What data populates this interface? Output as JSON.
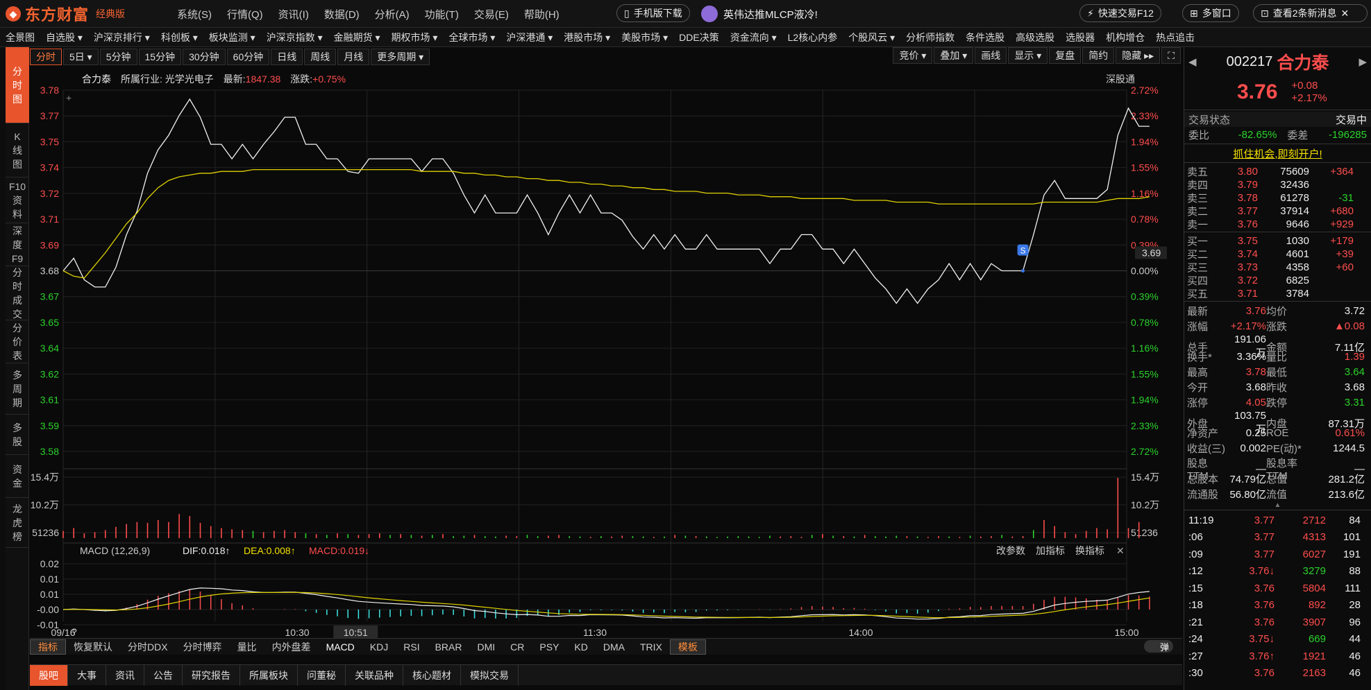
{
  "app": {
    "brand": "东方财富",
    "edition": "经典版"
  },
  "menu": [
    "系统(S)",
    "行情(Q)",
    "资讯(I)",
    "数据(D)",
    "分析(A)",
    "功能(T)",
    "交易(E)",
    "帮助(H)"
  ],
  "topbar": {
    "mobile_download": "手机版下载",
    "news_banner": "英伟达推MLCP液冷!",
    "quick_trade": "快速交易F12",
    "multi_window": "多窗口",
    "new_messages": "查看2条新消息"
  },
  "nav": [
    "全景图",
    "自选股 ▾",
    "沪深京排行 ▾",
    "科创板 ▾",
    "板块监测 ▾",
    "沪深京指数 ▾",
    "金融期货 ▾",
    "期权市场 ▾",
    "全球市场 ▾",
    "沪深港通 ▾",
    "港股市场 ▾",
    "美股市场 ▾",
    "DDE决策",
    "资金流向 ▾",
    "L2核心内参",
    "个股风云 ▾",
    "分析师指数",
    "条件选股",
    "高级选股",
    "选股器",
    "机构增仓",
    "热点追击"
  ],
  "left_tabs": [
    {
      "label": "分\n时\n图",
      "active": true
    },
    {
      "label": "K\n线\n图",
      "active": false
    },
    {
      "label": "F10\n资\n料",
      "active": false
    },
    {
      "label": "深\n度\nF9",
      "active": false
    },
    {
      "label": "分\n时\n成\n交",
      "active": false
    },
    {
      "label": "分\n价\n表",
      "active": false
    },
    {
      "label": "多\n周\n期",
      "active": false
    },
    {
      "label": "多\n股",
      "active": false
    },
    {
      "label": "资\n金",
      "active": false
    },
    {
      "label": "龙\n虎\n榜",
      "active": false
    }
  ],
  "periods": [
    "分时",
    "5日 ▾",
    "5分钟",
    "15分钟",
    "30分钟",
    "60分钟",
    "日线",
    "周线",
    "月线",
    "更多周期 ▾"
  ],
  "chart_tools": [
    "竞价 ▾",
    "叠加 ▾",
    "画线",
    "显示 ▾",
    "复盘",
    "简约",
    "隐藏 ▸▸"
  ],
  "info": {
    "name": "合力泰",
    "industry_label": "所属行业:",
    "industry": "光学光电子",
    "latest_label": "最新:",
    "latest": "1847.38",
    "change_label": "涨跌:",
    "change": "+0.75%",
    "connect": "深股通"
  },
  "chart_data": {
    "type": "line",
    "price_ticks_left": [
      "3.78",
      "3.77",
      "3.75",
      "3.74",
      "3.72",
      "3.71",
      "3.69",
      "3.68",
      "3.67",
      "3.65",
      "3.64",
      "3.62",
      "3.61",
      "3.59",
      "3.58"
    ],
    "pct_ticks_right": [
      "2.72%",
      "2.33%",
      "1.94%",
      "1.55%",
      "1.16%",
      "0.78%",
      "0.39%",
      "0.00%",
      "0.39%",
      "0.78%",
      "1.16%",
      "1.55%",
      "1.94%",
      "2.33%",
      "2.72%"
    ],
    "ylim": [
      3.58,
      3.78
    ],
    "prev_close": 3.68,
    "current_price_label": "3.69",
    "time_labels": [
      "09/16",
      "10:30",
      "10:51",
      "11:30",
      "14:00",
      "15:00"
    ],
    "price": [
      3.68,
      3.687,
      3.675,
      3.671,
      3.671,
      3.682,
      3.7,
      3.713,
      3.734,
      3.747,
      3.755,
      3.766,
      3.775,
      3.765,
      3.75,
      3.75,
      3.742,
      3.75,
      3.742,
      3.75,
      3.757,
      3.765,
      3.765,
      3.75,
      3.75,
      3.742,
      3.742,
      3.735,
      3.734,
      3.742,
      3.742,
      3.742,
      3.742,
      3.742,
      3.735,
      3.742,
      3.742,
      3.734,
      3.722,
      3.712,
      3.722,
      3.712,
      3.712,
      3.712,
      3.722,
      3.712,
      3.7,
      3.712,
      3.722,
      3.712,
      3.722,
      3.712,
      3.712,
      3.708,
      3.699,
      3.692,
      3.7,
      3.692,
      3.7,
      3.692,
      3.692,
      3.7,
      3.692,
      3.692,
      3.692,
      3.692,
      3.692,
      3.684,
      3.692,
      3.692,
      3.7,
      3.7,
      3.692,
      3.692,
      3.684,
      3.692,
      3.684,
      3.676,
      3.67,
      3.662,
      3.67,
      3.662,
      3.67,
      3.675,
      3.684,
      3.675,
      3.684,
      3.675,
      3.684,
      3.68,
      3.68,
      3.68,
      3.7,
      3.722,
      3.73,
      3.72,
      3.72,
      3.72,
      3.72,
      3.725,
      3.755,
      3.77,
      3.76,
      3.76
    ],
    "avg_price": [
      3.68,
      3.677,
      3.676,
      3.683,
      3.69,
      3.698,
      3.706,
      3.712,
      3.72,
      3.726,
      3.73,
      3.732,
      3.733,
      3.734,
      3.734,
      3.735,
      3.735,
      3.735,
      3.736,
      3.736,
      3.736,
      3.736,
      3.736,
      3.736,
      3.736,
      3.736,
      3.736,
      3.736,
      3.736,
      3.736,
      3.736,
      3.736,
      3.736,
      3.736,
      3.735,
      3.735,
      3.735,
      3.735,
      3.734,
      3.734,
      3.733,
      3.733,
      3.732,
      3.732,
      3.731,
      3.731,
      3.73,
      3.73,
      3.729,
      3.729,
      3.728,
      3.728,
      3.727,
      3.727,
      3.726,
      3.726,
      3.725,
      3.725,
      3.724,
      3.724,
      3.724,
      3.723,
      3.723,
      3.723,
      3.722,
      3.722,
      3.722,
      3.721,
      3.721,
      3.721,
      3.72,
      3.72,
      3.72,
      3.72,
      3.72,
      3.719,
      3.719,
      3.719,
      3.719,
      3.718,
      3.718,
      3.718,
      3.718,
      3.717,
      3.717,
      3.717,
      3.717,
      3.717,
      3.717,
      3.717,
      3.717,
      3.717,
      3.717,
      3.718,
      3.718,
      3.718,
      3.718,
      3.718,
      3.718,
      3.719,
      3.72,
      3.72,
      3.72,
      3.721
    ],
    "volume_ticks": [
      "15.4万",
      "10.2万",
      "51236"
    ],
    "volume": [
      18,
      25,
      12,
      15,
      20,
      28,
      35,
      40,
      38,
      45,
      40,
      60,
      55,
      38,
      30,
      25,
      22,
      20,
      18,
      15,
      18,
      20,
      15,
      12,
      10,
      8,
      12,
      10,
      8,
      10,
      12,
      8,
      10,
      8,
      6,
      8,
      10,
      5,
      6,
      8,
      5,
      4,
      6,
      5,
      8,
      5,
      6,
      8,
      5,
      4,
      3,
      5,
      4,
      6,
      5,
      4,
      3,
      4,
      8,
      6,
      5,
      4,
      3,
      4,
      5,
      4,
      3,
      6,
      4,
      5,
      3,
      8,
      10,
      6,
      5,
      4,
      8,
      5,
      4,
      6,
      5,
      4,
      3,
      5,
      4,
      3,
      6,
      4,
      5,
      8,
      4,
      5,
      20,
      45,
      30,
      15,
      10,
      18,
      25,
      22,
      150,
      25,
      40
    ],
    "volume_colors": [
      "r",
      "r",
      "r",
      "r",
      "r",
      "r",
      "r",
      "r",
      "r",
      "r",
      "r",
      "r",
      "r",
      "r",
      "r",
      "r",
      "r",
      "r",
      "g",
      "r",
      "r",
      "r",
      "r",
      "g",
      "r",
      "g",
      "r",
      "g",
      "r",
      "r",
      "r",
      "g",
      "r",
      "g",
      "r",
      "g",
      "r",
      "g",
      "g",
      "r",
      "g",
      "g",
      "r",
      "r",
      "g",
      "g",
      "r",
      "r",
      "g",
      "g",
      "r",
      "g",
      "r",
      "r",
      "g",
      "g",
      "r",
      "g",
      "r",
      "g",
      "r",
      "g",
      "g",
      "g",
      "g",
      "g",
      "g",
      "g",
      "r",
      "r",
      "r",
      "g",
      "r",
      "g",
      "r",
      "g",
      "r",
      "g",
      "g",
      "g",
      "r",
      "g",
      "r",
      "r",
      "g",
      "r",
      "g",
      "r",
      "r",
      "g",
      "r",
      "r",
      "g",
      "r",
      "r",
      "r",
      "r",
      "r",
      "r",
      "r",
      "r",
      "r",
      "r",
      "r"
    ],
    "macd_ticks": [
      "0.02",
      "0.01",
      "0.01",
      "-0.00",
      "-0.01"
    ],
    "macd_header": {
      "name": "MACD (12,26,9)",
      "dif": "DIF:0.018↑",
      "dea": "DEA:0.008↑",
      "macd": "MACD:0.019↓"
    },
    "macd_tools": [
      "改参数",
      "加指标",
      "换指标"
    ]
  },
  "indicator_tabs": [
    "指标",
    "恢复默认",
    "分时DDX",
    "分时博弈",
    "量比",
    "内外盘差",
    "MACD",
    "KDJ",
    "RSI",
    "BRAR",
    "DMI",
    "CR",
    "PSY",
    "KD",
    "DMA",
    "TRIX",
    "模板"
  ],
  "popup_toggle": "弹",
  "low_tabs": [
    "股吧",
    "大事",
    "资讯",
    "公告",
    "研究报告",
    "所属板块",
    "问董秘",
    "关联品种",
    "核心题材",
    "模拟交易"
  ],
  "quote": {
    "code": "002217",
    "name": "合力泰",
    "price": "3.76",
    "change": "+0.08",
    "pct": "+2.17%",
    "status_label": "交易状态",
    "status": "交易中",
    "wb_label": "委比",
    "wb": "-82.65%",
    "wc_label": "委差",
    "wc": "-196285",
    "promo": "抓住机会,即刻开户!",
    "asks": [
      {
        "label": "卖五",
        "price": "3.80",
        "vol": "75609",
        "chg": "+364"
      },
      {
        "label": "卖四",
        "price": "3.79",
        "vol": "32436",
        "chg": ""
      },
      {
        "label": "卖三",
        "price": "3.78",
        "vol": "61278",
        "chg": "-31"
      },
      {
        "label": "卖二",
        "price": "3.77",
        "vol": "37914",
        "chg": "+680"
      },
      {
        "label": "卖一",
        "price": "3.76",
        "vol": "9646",
        "chg": "+929"
      }
    ],
    "bids": [
      {
        "label": "买一",
        "price": "3.75",
        "vol": "1030",
        "chg": "+179"
      },
      {
        "label": "买二",
        "price": "3.74",
        "vol": "4601",
        "chg": "+39"
      },
      {
        "label": "买三",
        "price": "3.73",
        "vol": "4358",
        "chg": "+60"
      },
      {
        "label": "买四",
        "price": "3.72",
        "vol": "6825",
        "chg": ""
      },
      {
        "label": "买五",
        "price": "3.71",
        "vol": "3784",
        "chg": ""
      }
    ],
    "stats": [
      [
        "最新",
        "3.76",
        "均价",
        "3.72"
      ],
      [
        "涨幅",
        "+2.17%",
        "涨跌",
        "▲0.08"
      ],
      [
        "总手",
        "191.06万",
        "金额",
        "7.11亿"
      ],
      [
        "换手*",
        "3.36%",
        "量比",
        "1.39"
      ],
      [
        "最高",
        "3.78",
        "最低",
        "3.64"
      ],
      [
        "今开",
        "3.68",
        "昨收",
        "3.68"
      ],
      [
        "涨停",
        "4.05",
        "跌停",
        "3.31"
      ],
      [
        "外盘",
        "103.75万",
        "内盘",
        "87.31万"
      ],
      [
        "净资产",
        "0.25",
        "ROE",
        "0.61%"
      ],
      [
        "收益(三)",
        "0.002",
        "PE(动)*",
        "1244.5"
      ],
      [
        "股息TTM",
        "—",
        "股息率TTM",
        "—"
      ],
      [
        "总股本",
        "74.79亿",
        "总值",
        "281.2亿"
      ],
      [
        "流通股",
        "56.80亿",
        "流值",
        "213.6亿"
      ]
    ],
    "ticks": [
      [
        "11:19",
        "3.77",
        "2712",
        "84",
        ""
      ],
      [
        ":06",
        "3.77",
        "4313",
        "101",
        ""
      ],
      [
        ":09",
        "3.77",
        "6027",
        "191",
        ""
      ],
      [
        ":12",
        "3.76↓",
        "3279",
        "88",
        "g"
      ],
      [
        ":15",
        "3.76",
        "5804",
        "111",
        ""
      ],
      [
        ":18",
        "3.76",
        "892",
        "28",
        ""
      ],
      [
        ":21",
        "3.76",
        "3907",
        "96",
        ""
      ],
      [
        ":24",
        "3.75↓",
        "669",
        "44",
        "g"
      ],
      [
        ":27",
        "3.76↑",
        "1921",
        "46",
        ""
      ],
      [
        ":30",
        "3.76",
        "2163",
        "46",
        ""
      ]
    ]
  }
}
